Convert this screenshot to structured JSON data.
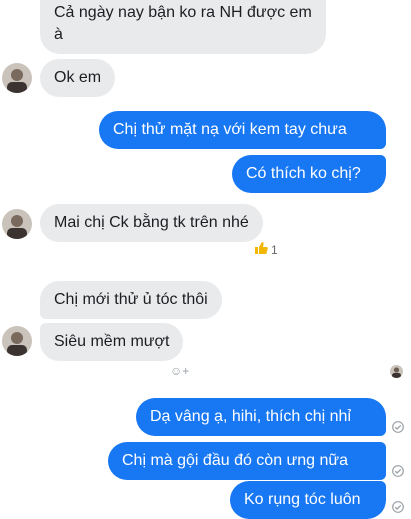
{
  "messages": [
    {
      "id": "m1",
      "side": "in",
      "text": "Cả ngày nay bận ko ra NH được em à"
    },
    {
      "id": "m2",
      "side": "in",
      "text": "Ok em"
    },
    {
      "id": "m3",
      "side": "out",
      "text": "Chị thử mặt nạ với kem tay chưa"
    },
    {
      "id": "m4",
      "side": "out",
      "text": "Có thích ko chị?"
    },
    {
      "id": "m5",
      "side": "in",
      "text": "Mai chị Ck bằng tk trên nhé"
    },
    {
      "id": "m6",
      "side": "in",
      "text": "Chị mới thử ủ tóc thôi"
    },
    {
      "id": "m7",
      "side": "in",
      "text": "Siêu mềm mượt"
    },
    {
      "id": "m8",
      "side": "out",
      "text": "Dạ vâng ạ, hihi, thích chị nhỉ"
    },
    {
      "id": "m9",
      "side": "out",
      "text": "Chị mà gội đầu đó còn ưng nữa"
    },
    {
      "id": "m10",
      "side": "out",
      "text": "Ko rụng tóc luôn"
    }
  ],
  "reaction": {
    "icon": "thumbs-up-icon",
    "count": "1"
  },
  "colors": {
    "incoming": "#e9eaec",
    "outgoing": "#1877f2"
  }
}
